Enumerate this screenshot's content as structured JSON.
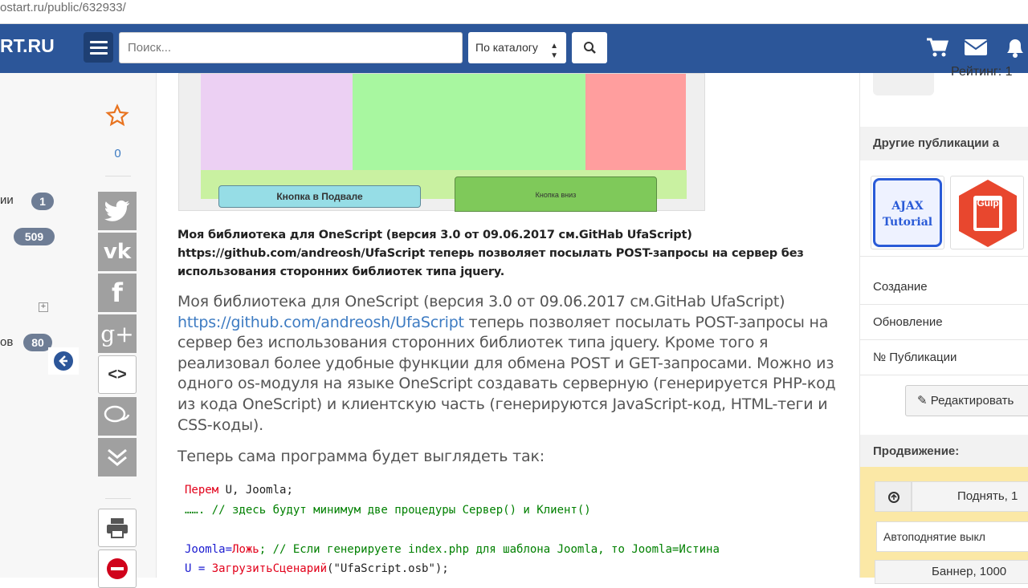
{
  "browser": {
    "url": "ostart.ru/public/632933/"
  },
  "header": {
    "logo": "RT.RU",
    "search_placeholder": "Поиск...",
    "catalog_select": "По каталогу"
  },
  "left_sidebar": {
    "items": [
      {
        "label": "ии",
        "count": "1"
      },
      {
        "label": "",
        "count": "509"
      },
      {
        "label": "ов",
        "count": "80"
      }
    ]
  },
  "share": {
    "favorites_count": "0"
  },
  "preview": {
    "footer_button": "Кнопка в Подвале",
    "down_button": "Кнопка вниз"
  },
  "content": {
    "bold_description": "Моя библиотека для OneScript (версия 3.0 от 09.06.2017 см.GitHab UfaScript) https://github.com/andreosh/UfaScript теперь позволяет посылать POST-запросы на сервер без использования сторонних библиотек типа jquery.",
    "desc_part1": "Моя библиотека для OneScript (версия 3.0 от 09.06.2017 см.GitHab UfaScript) ",
    "desc_link": "https://github.com/andreosh/UfaScript",
    "desc_part2": " теперь позволяет посылать POST-запросы на сервер без использования сторонних библиотек типа jquery. Кроме того я реализовал более удобные функции для обмена POST и GET-запросами. Можно из одного os-модуля на языке OneScript создавать серверную (генерируется PHP-код из кода OneScript) и клиентскую часть (генерируются JavaScript-код, HTML-теги и CSS-коды).",
    "desc_next": "Теперь сама программа будет выглядеть так:",
    "code": {
      "line1_kw": "Перем",
      "line1_rest": " U, Joomla;",
      "line2": "……. // здесь будут минимум две процедуры Сервер() и Клиент()",
      "line3_a": "Joomla=",
      "line3_kw": "Ложь",
      "line3_b": "; // Если генерируете index.php для шаблона Joomla, то Joomla=Истина",
      "line4_a": "U = ",
      "line4_kw": "ЗагрузитьСценарий",
      "line4_b": "(\"UfaScript.osb\");"
    }
  },
  "right_sidebar": {
    "rating": "Рейтинг: 1",
    "other_publications": "Другие публикации а",
    "thumb1": "AJAX Tutorial",
    "thumb2": "Gulp",
    "created": "Создание",
    "updated": "Обновление",
    "pub_number": "№ Публикации",
    "edit_button": "Редактировать",
    "promotion": "Продвижение:",
    "lift_button": "Поднять, 1",
    "auto_lift": "Автоподнятие выкл",
    "banner": "Баннер, 1000"
  },
  "colors": {
    "nav_bg": "#2c5699",
    "accent": "#3d7bc2",
    "badge": "#6e7d95",
    "share_btn": "#a0a0a0",
    "promo_bg": "#fbe8a6"
  }
}
